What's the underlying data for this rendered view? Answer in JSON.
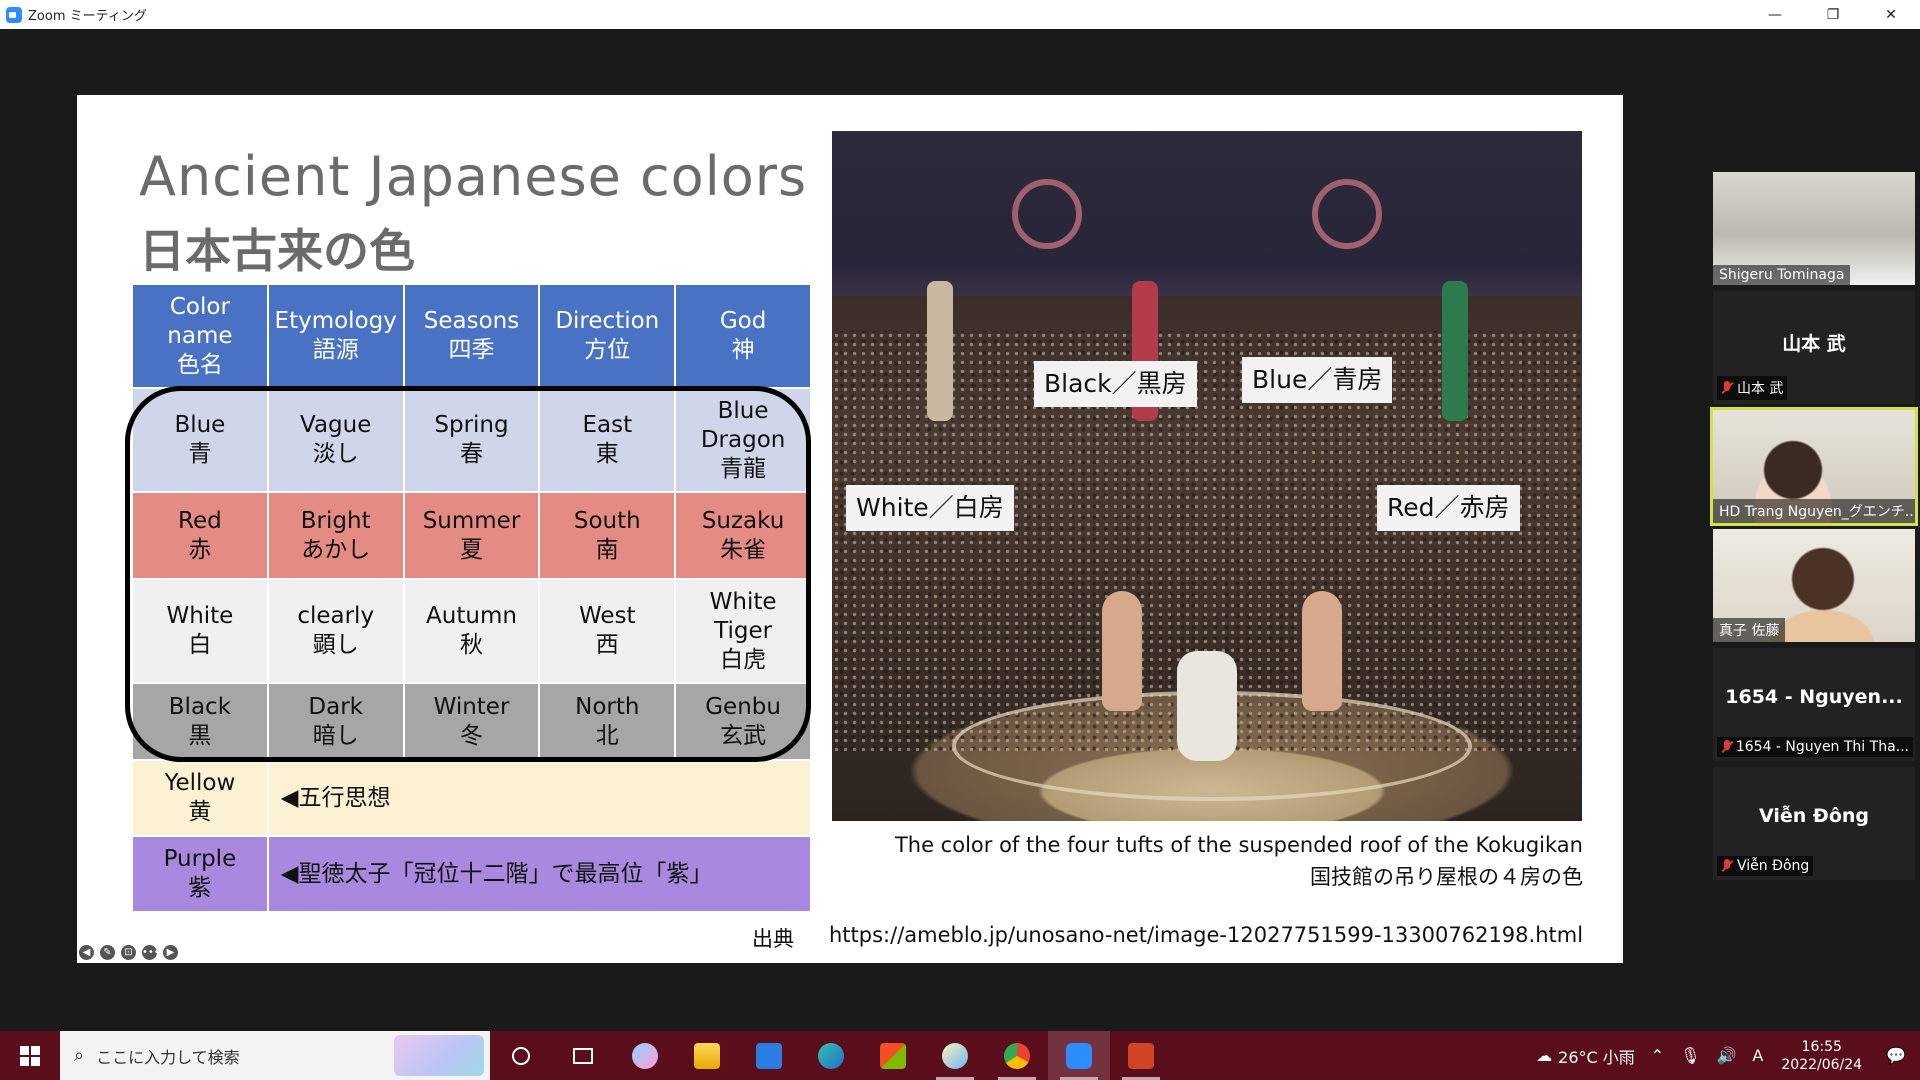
{
  "window": {
    "title": "Zoom ミーティング",
    "controls": {
      "minimize": "—",
      "maximize": "❐",
      "close": "✕"
    }
  },
  "slide": {
    "title_en": "Ancient Japanese colors",
    "title_ja": "日本古来の色",
    "table": {
      "headers": [
        {
          "en": "Color",
          "en2": "name",
          "ja": "色名"
        },
        {
          "en": "Etymology",
          "ja": "語源"
        },
        {
          "en": "Seasons",
          "ja": "四季"
        },
        {
          "en": "Direction",
          "ja": "方位"
        },
        {
          "en": "God",
          "ja": "神"
        }
      ],
      "rows": [
        {
          "color": [
            "Blue",
            "青"
          ],
          "etymology": [
            "Vague",
            "淡し"
          ],
          "season": [
            "Spring",
            "春"
          ],
          "direction": [
            "East",
            "東"
          ],
          "god": [
            "Blue",
            "Dragon",
            "青龍"
          ]
        },
        {
          "color": [
            "Red",
            "赤"
          ],
          "etymology": [
            "Bright",
            "あかし"
          ],
          "season": [
            "Summer",
            "夏"
          ],
          "direction": [
            "South",
            "南"
          ],
          "god": [
            "Suzaku",
            "朱雀"
          ]
        },
        {
          "color": [
            "White",
            "白"
          ],
          "etymology": [
            "clearly",
            "顕し"
          ],
          "season": [
            "Autumn",
            "秋"
          ],
          "direction": [
            "West",
            "西"
          ],
          "god": [
            "White",
            "Tiger",
            "白虎"
          ]
        },
        {
          "color": [
            "Black",
            "黒"
          ],
          "etymology": [
            "Dark",
            "暗し"
          ],
          "season": [
            "Winter",
            "冬"
          ],
          "direction": [
            "North",
            "北"
          ],
          "god": [
            "Genbu",
            "玄武"
          ]
        }
      ],
      "extra_rows": [
        {
          "color": [
            "Yellow",
            "黄"
          ],
          "note": "◀五行思想"
        },
        {
          "color": [
            "Purple",
            "紫"
          ],
          "note": "◀聖徳太子「冠位十二階」で最高位「紫」"
        }
      ]
    },
    "photo_labels": {
      "black": "Black／黒房",
      "blue": "Blue／青房",
      "white": "White／白房",
      "red": "Red／赤房"
    },
    "caption_en": "The color of the four tufts of the suspended roof of the Kokugikan",
    "caption_ja": "国技館の吊り屋根の４房の色",
    "source_label": "出典",
    "source_url": "https://ameblo.jp/unosano-net/image-12027751599-13300762198.html",
    "tools": [
      "◀",
      "✎",
      "⊡",
      "•••",
      "▶"
    ]
  },
  "participants": [
    {
      "type": "video",
      "name": "Shigeru Tominaga"
    },
    {
      "type": "name",
      "display": "山本 武",
      "name": "山本 武",
      "muted": true
    },
    {
      "type": "video",
      "name": "HD Trang Nguyen_グエンチ...",
      "active": true
    },
    {
      "type": "video",
      "name": "真子 佐藤"
    },
    {
      "type": "name",
      "display": "1654 - Nguyen...",
      "name": "1654 - Nguyen Thi Tha...",
      "muted": true
    },
    {
      "type": "name",
      "display": "Viễn Đông",
      "name": "Viễn Đông",
      "muted": true
    }
  ],
  "taskbar": {
    "search_placeholder": "ここに入力して検索",
    "weather": "26°C 小雨",
    "ime": "A",
    "time": "16:55",
    "date": "2022/06/24"
  }
}
